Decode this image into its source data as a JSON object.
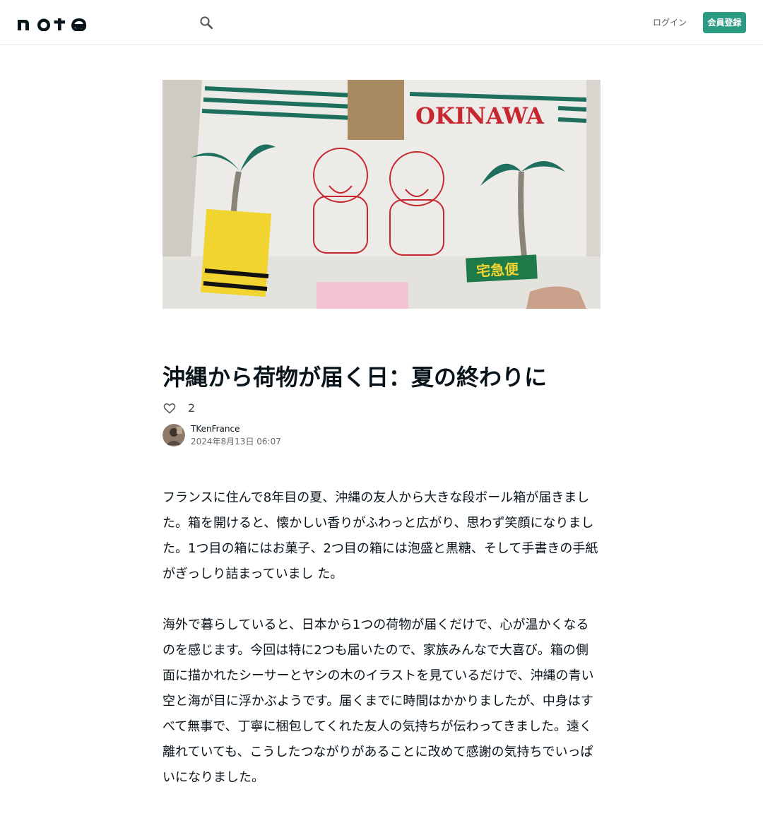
{
  "header": {
    "logo_text": "note",
    "search_icon": "search-icon",
    "login_label": "ログイン",
    "signup_label": "会員登録",
    "accent_color": "#2b9b84"
  },
  "hero": {
    "box_text": "OKINAWA",
    "stamp_text": "宅急便"
  },
  "article": {
    "title": "沖縄から荷物が届く日：夏の終わりに",
    "like_count": "2",
    "like_icon": "heart-outline-icon",
    "author_name": "TKenFrance",
    "date": "2024年8月13日 06:07",
    "paragraphs": [
      "フランスに住んで8年目の夏、沖縄の友人から大きな段ボール箱が届きました。箱を開けると、懐かしい香りがふわっと広がり、思わず笑顔になりました。1つ目の箱にはお菓子、2つ目の箱には泡盛と黒糖、そして手書きの手紙がぎっしり詰まっていまし た。",
      "海外で暮らしていると、日本から1つの荷物が届くだけで、心が温かくなるのを感じます。今回は特に2つも届いたので、家族みんなで大喜び。箱の側面に描かれたシーサーとヤシの木のイラストを見ているだけで、沖縄の青い空と海が目に浮かぶようです。届くまでに時間はかかりましたが、中身はすべて無事で、丁寧に梱包してくれた友人の気持ちが伝わってきました。遠く離れていても、こうしたつながりがあることに改めて感謝の気持ちでいっぱいになりました。"
    ]
  }
}
